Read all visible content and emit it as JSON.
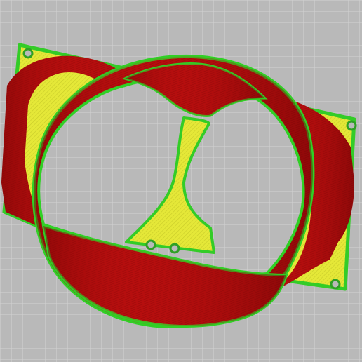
{
  "viewer": {
    "colors": {
      "background": "#b9b9b9",
      "grid_line": "#d6d6d6",
      "perimeter": "#36d02a",
      "infill": "#e6e83a",
      "wall": "#b30d0d",
      "wall_dark": "#7a0606",
      "wall_light": "#d81818"
    }
  }
}
